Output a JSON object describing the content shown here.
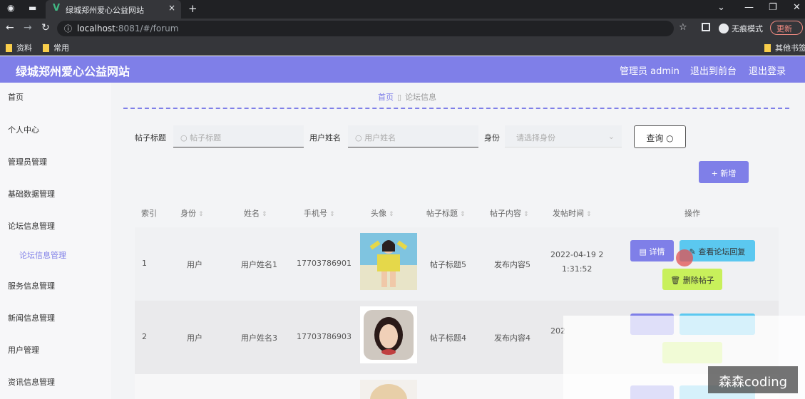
{
  "browser": {
    "tab_title": "绿城郑州爱心公益网站",
    "tab_close": "×",
    "new_tab": "+",
    "url_host": "localhost",
    "url_rest": ":8081/#/forum",
    "incognito_label": "无痕模式",
    "update_label": "更新",
    "bookmarks": [
      "资料",
      "常用"
    ],
    "other_bookmarks": "其他书签"
  },
  "header": {
    "title": "绿城郑州爱心公益网站",
    "admin": "管理员 admin",
    "to_front": "退出到前台",
    "logout": "退出登录"
  },
  "sidebar": {
    "items": [
      "首页",
      "个人中心",
      "管理员管理",
      "基础数据管理",
      "论坛信息管理",
      "论坛信息管理",
      "服务信息管理",
      "新闻信息管理",
      "用户管理",
      "资讯信息管理"
    ]
  },
  "breadcrumb": {
    "home": "首页",
    "current": "论坛信息"
  },
  "search": {
    "title_label": "帖子标题",
    "title_placeholder": "帖子标题",
    "user_label": "用户姓名",
    "user_placeholder": "用户姓名",
    "role_label": "身份",
    "role_placeholder": "请选择身份",
    "search_button": "查询"
  },
  "add_button": "+ 新增",
  "table": {
    "headers": [
      "索引",
      "身份",
      "姓名",
      "手机号",
      "头像",
      "帖子标题",
      "帖子内容",
      "发帖时间",
      "操作"
    ],
    "rows": [
      {
        "index": "1",
        "role": "用户",
        "name": "用户姓名1",
        "phone": "17703786901",
        "title": "帖子标题5",
        "content": "发布内容5",
        "time_line1": "2022-04-19 2",
        "time_line2": "1:31:52"
      },
      {
        "index": "2",
        "role": "用户",
        "name": "用户姓名3",
        "phone": "17703786903",
        "title": "帖子标题4",
        "content": "发布内容4",
        "time_line1": "202",
        "time_line2": ""
      }
    ],
    "actions": {
      "detail": "详情",
      "view_replies": "查看论坛回复",
      "delete": "删除帖子"
    }
  },
  "watermark": "森森coding",
  "colors": {
    "accent": "#7f7fe8",
    "cyan": "#5bc8f0",
    "lime": "#c8f05b"
  }
}
